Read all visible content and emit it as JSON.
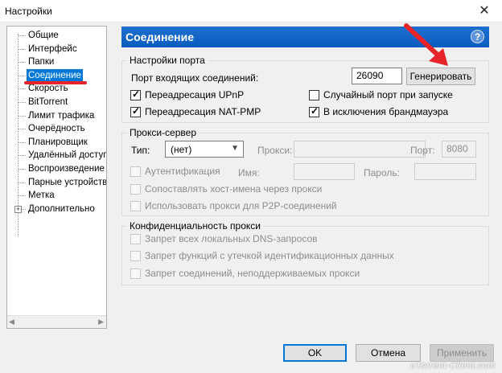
{
  "window": {
    "title": "Настройки",
    "close_glyph": "✕"
  },
  "sidebar": {
    "items": [
      {
        "label": "Общие"
      },
      {
        "label": "Интерфейс"
      },
      {
        "label": "Папки"
      },
      {
        "label": "Соединение",
        "selected": true
      },
      {
        "label": "Скорость"
      },
      {
        "label": "BitTorrent"
      },
      {
        "label": "Лимит трафика"
      },
      {
        "label": "Очерёдность"
      },
      {
        "label": "Планировщик"
      },
      {
        "label": "Удалённый доступ"
      },
      {
        "label": "Воспроизведение"
      },
      {
        "label": "Парные устройства"
      },
      {
        "label": "Метка"
      },
      {
        "label": "Дополнительно",
        "expandable": true
      }
    ],
    "expander_glyph": "+"
  },
  "panel": {
    "title": "Соединение",
    "help_glyph": "?"
  },
  "port_settings": {
    "group_title": "Настройки порта",
    "incoming_label": "Порт входящих соединений:",
    "port_value": "26090",
    "generate_button": "Генерировать",
    "upnp": {
      "label": "Переадресация UPnP",
      "checked": true
    },
    "natpmp": {
      "label": "Переадресация NAT-PMP",
      "checked": true
    },
    "random_port": {
      "label": "Случайный порт при запуске",
      "checked": false
    },
    "firewall": {
      "label": "В исключения брандмауэра",
      "checked": true
    }
  },
  "proxy": {
    "group_title": "Прокси-сервер",
    "type_label": "Тип:",
    "type_value": "(нет)",
    "proxy_label": "Прокси:",
    "proxy_value": "",
    "port_label": "Порт:",
    "port_value": "8080",
    "auth": {
      "label": "Аутентификация",
      "checked": false
    },
    "name_label": "Имя:",
    "password_label": "Пароль:",
    "resolve_hostnames": {
      "label": "Сопоставлять хост-имена через прокси",
      "checked": false
    },
    "p2p": {
      "label": "Использовать прокси для P2P-соединений",
      "checked": false
    }
  },
  "privacy": {
    "group_title": "Конфиденциальность прокси",
    "dns": {
      "label": "Запрет всех локальных DNS-запросов",
      "checked": false
    },
    "leak": {
      "label": "Запрет функций с утечкой идентификационных данных",
      "checked": false
    },
    "unsupported": {
      "label": "Запрет соединений, неподдерживаемых прокси",
      "checked": false
    }
  },
  "buttons": {
    "ok": "OK",
    "cancel": "Отмена",
    "apply": "Применить"
  },
  "watermark": "uTorrent-Client.com",
  "colors": {
    "header": "#0b5cbf",
    "selection": "#0078d7",
    "annotation": "#e8242b"
  }
}
